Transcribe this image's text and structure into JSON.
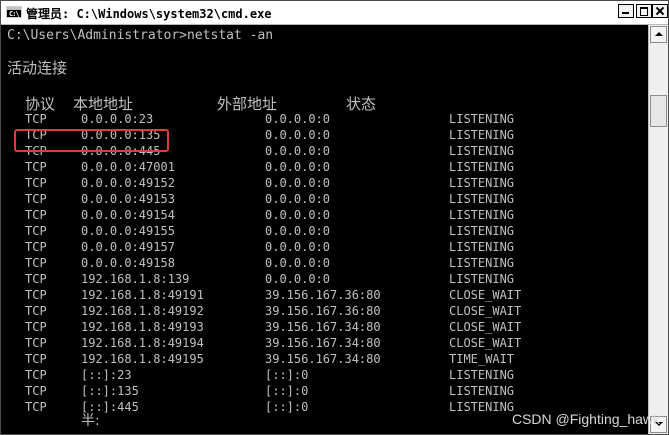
{
  "window": {
    "title": "管理员: C:\\Windows\\system32\\cmd.exe",
    "icon_text": "C:\\"
  },
  "console": {
    "command_line": "C:\\Users\\Administrator>netstat -an",
    "section_title": "活动连接",
    "headers": {
      "proto": "协议",
      "local": "本地地址",
      "foreign": "外部地址",
      "state": "状态"
    },
    "rows": [
      {
        "proto": "TCP",
        "local": "0.0.0.0:23",
        "foreign": "0.0.0.0:0",
        "state": "LISTENING"
      },
      {
        "proto": "TCP",
        "local": "0.0.0.0:135",
        "foreign": "0.0.0.0:0",
        "state": "LISTENING"
      },
      {
        "proto": "TCP",
        "local": "0.0.0.0:445",
        "foreign": "0.0.0.0:0",
        "state": "LISTENING"
      },
      {
        "proto": "TCP",
        "local": "0.0.0.0:47001",
        "foreign": "0.0.0.0:0",
        "state": "LISTENING"
      },
      {
        "proto": "TCP",
        "local": "0.0.0.0:49152",
        "foreign": "0.0.0.0:0",
        "state": "LISTENING"
      },
      {
        "proto": "TCP",
        "local": "0.0.0.0:49153",
        "foreign": "0.0.0.0:0",
        "state": "LISTENING"
      },
      {
        "proto": "TCP",
        "local": "0.0.0.0:49154",
        "foreign": "0.0.0.0:0",
        "state": "LISTENING"
      },
      {
        "proto": "TCP",
        "local": "0.0.0.0:49155",
        "foreign": "0.0.0.0:0",
        "state": "LISTENING"
      },
      {
        "proto": "TCP",
        "local": "0.0.0.0:49157",
        "foreign": "0.0.0.0:0",
        "state": "LISTENING"
      },
      {
        "proto": "TCP",
        "local": "0.0.0.0:49158",
        "foreign": "0.0.0.0:0",
        "state": "LISTENING"
      },
      {
        "proto": "TCP",
        "local": "192.168.1.8:139",
        "foreign": "0.0.0.0:0",
        "state": "LISTENING"
      },
      {
        "proto": "TCP",
        "local": "192.168.1.8:49191",
        "foreign": "39.156.167.36:80",
        "state": "CLOSE_WAIT"
      },
      {
        "proto": "TCP",
        "local": "192.168.1.8:49192",
        "foreign": "39.156.167.36:80",
        "state": "CLOSE_WAIT"
      },
      {
        "proto": "TCP",
        "local": "192.168.1.8:49193",
        "foreign": "39.156.167.34:80",
        "state": "CLOSE_WAIT"
      },
      {
        "proto": "TCP",
        "local": "192.168.1.8:49194",
        "foreign": "39.156.167.34:80",
        "state": "CLOSE_WAIT"
      },
      {
        "proto": "TCP",
        "local": "192.168.1.8:49195",
        "foreign": "39.156.167.34:80",
        "state": "TIME_WAIT"
      },
      {
        "proto": "TCP",
        "local": "[::]:23",
        "foreign": "[::]:0",
        "state": "LISTENING"
      },
      {
        "proto": "TCP",
        "local": "[::]:135",
        "foreign": "[::]:0",
        "state": "LISTENING"
      },
      {
        "proto": "TCP",
        "local": "[::]:445",
        "foreign": "[::]:0",
        "state": "LISTENING"
      }
    ],
    "partial_line": "半:"
  },
  "watermark": "CSDN @Fighting_hawk",
  "colors": {
    "console_bg": "#000000",
    "console_text": "#c0c0c0",
    "highlight": "#e23b3b"
  }
}
